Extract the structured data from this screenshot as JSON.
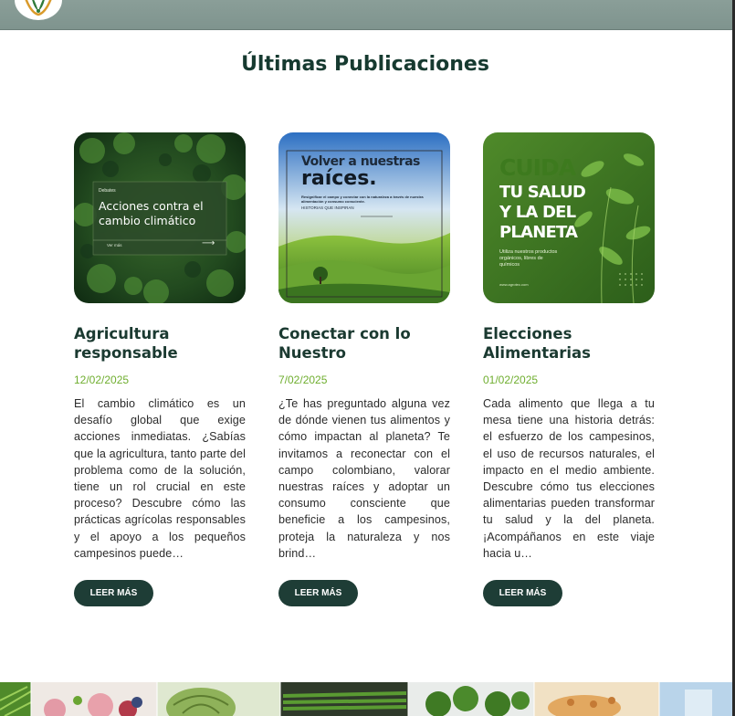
{
  "section_title": "Últimas Publicaciones",
  "posts": [
    {
      "title": "Agricultura responsable",
      "date": "12/02/2025",
      "excerpt": "El cambio climático es un desafío global que exige acciones inmediatas. ¿Sabías que la agricultura, tanto parte del problema como de la solución, tiene un rol crucial en este proceso? Descubre cómo las prácticas agrícolas responsables y el apoyo a los pequeños campesinos puede…",
      "button": "LEER MÁS",
      "image": {
        "tag": "Debates",
        "headline": "Acciones contra el cambio climático",
        "link": "Ver más"
      }
    },
    {
      "title": "Conectar con lo Nuestro",
      "date": "7/02/2025",
      "excerpt": "¿Te has preguntado alguna vez de dónde vienen tus alimentos y cómo impactan al planeta? Te invitamos a reconectar con el campo colombiano, valorar nuestras raíces y adoptar un consumo consciente que beneficie a los campesinos, proteja la naturaleza y nos brind…",
      "button": "LEER MÁS",
      "image": {
        "line1": "Volver a nuestras",
        "line2": "raíces.",
        "sub": "Resignificar el campo y conectar con la naturaleza a través de nuestra alimentación y consumo consciente.",
        "caption": "HISTORIAS QUE INSPIRAN"
      }
    },
    {
      "title": "Elecciones Alimentarias",
      "date": "01/02/2025",
      "excerpt": "Cada alimento que llega a tu mesa tiene una historia detrás: el esfuerzo de los campesinos, el uso de recursos naturales, el impacto en el medio ambiente. Descubre cómo tus elecciones alimentarias pueden transformar tu salud y la del planeta. ¡Acompáñanos en este viaje hacia u…",
      "button": "LEER MÁS",
      "image": {
        "line1": "CUIDA",
        "line2": "TU SALUD",
        "line3": "Y LA DEL",
        "line4": "PLANETA",
        "sub": "Utiliza nuestros productos orgánicos, libres de químicos",
        "url": "www.agrotec.com"
      }
    }
  ],
  "colors": {
    "header": "#849892",
    "title": "#163a30",
    "date": "#6fae2f",
    "button": "#1e3d36"
  }
}
